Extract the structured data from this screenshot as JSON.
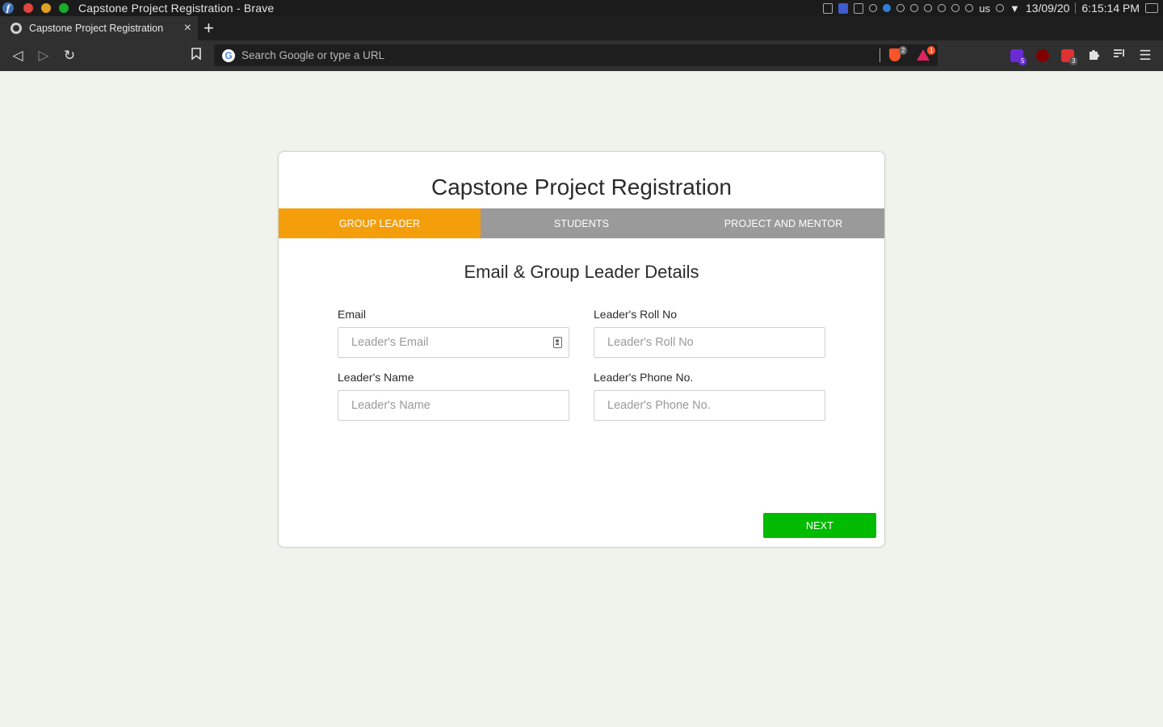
{
  "os": {
    "window_title": "Capstone Project Registration - Brave",
    "keyboard_layout": "us",
    "date": "13/09/20",
    "time": "6:15:14 PM"
  },
  "browser": {
    "tab_title": "Capstone Project Registration",
    "tab_close": "×",
    "new_tab": "+",
    "url_placeholder": "Search Google or type a URL",
    "shield_badge": "2",
    "rewards_badge": "1",
    "extension_badges": [
      "5",
      "3"
    ],
    "icons": {
      "back": "◁",
      "forward": "▷",
      "reload": "↻",
      "bookmark": "bookmark-icon",
      "extensions": "puzzle-icon",
      "playlist": "playlist-icon",
      "menu": "☰"
    }
  },
  "page": {
    "title": "Capstone Project Registration",
    "steps": [
      "GROUP LEADER",
      "STUDENTS",
      "PROJECT AND MENTOR"
    ],
    "active_step": 0,
    "section_title": "Email & Group Leader Details",
    "fields": {
      "email": {
        "label": "Email",
        "placeholder": "Leader's Email"
      },
      "roll": {
        "label": "Leader's Roll No",
        "placeholder": "Leader's Roll No"
      },
      "name": {
        "label": "Leader's Name",
        "placeholder": "Leader's Name"
      },
      "phone": {
        "label": "Leader's Phone No.",
        "placeholder": "Leader's Phone No."
      }
    },
    "next_label": "NEXT",
    "colors": {
      "active_step": "#f59e0b",
      "inactive_step": "#9a9a9a",
      "next_button": "#00bb00",
      "page_bg": "#f0f2ec"
    }
  }
}
